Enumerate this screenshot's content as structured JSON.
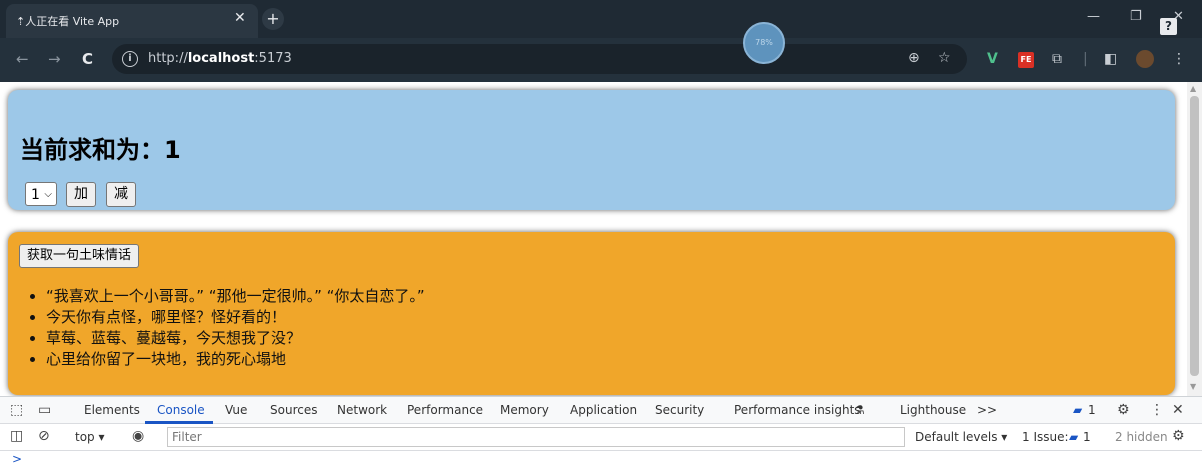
{
  "browser": {
    "tab": {
      "title": "⇡人正在看 Vite App",
      "close_glyph": "✕"
    },
    "new_tab_glyph": "+",
    "window_controls": {
      "minimize": "—",
      "restore": "❐",
      "close": "✕"
    },
    "help_badge": "?",
    "nav": {
      "back_icon": "←",
      "forward_icon": "→",
      "reload_icon": "C"
    },
    "address": {
      "scheme": "http://",
      "host": "localhost",
      "port": ":5173"
    },
    "omnibox_icons": {
      "zoom": "⊕",
      "bookmark": "☆"
    },
    "extensions": {
      "vue": "V",
      "fe": "FE",
      "menu": "⋮"
    },
    "floating_badge": "78%"
  },
  "page": {
    "count": {
      "label": "当前求和为：",
      "value": "1",
      "step_select": "1",
      "add_label": "加",
      "subtract_label": "减"
    },
    "talks": {
      "fetch_label": "获取一句土味情话",
      "items": [
        "“我喜欢上一个小哥哥。” “那他一定很帅。” “你太自恋了。”",
        "今天你有点怪，哪里怪？怪好看的！",
        "草莓、蓝莓、蔓越莓，今天想我了没？",
        "心里给你留了一块地，我的死心塌地"
      ]
    }
  },
  "devtools": {
    "tabs": [
      "Elements",
      "Console",
      "Vue",
      "Sources",
      "Network",
      "Performance",
      "Memory",
      "Application",
      "Security",
      "Performance insights",
      "Lighthouse"
    ],
    "active_tab": "Console",
    "more_tabs": ">>",
    "issues_badge_count": "1",
    "context": "top",
    "filter_placeholder": "Filter",
    "default_levels": "Default levels",
    "issues_label": "1 Issue:",
    "issues_count": "1",
    "hidden_label": "2 hidden",
    "prompt": ">",
    "colors": {
      "accent": "#1a55c4"
    }
  },
  "colors": {
    "count_panel": "#9dc8e8",
    "talk_panel": "#f0a62a",
    "browser_frame": "#1f2a34"
  }
}
